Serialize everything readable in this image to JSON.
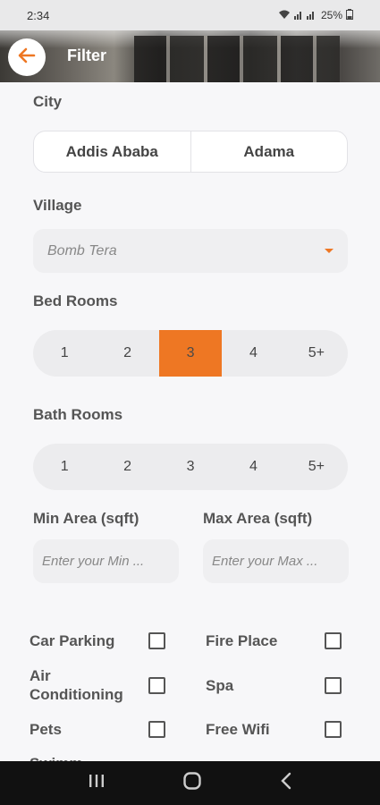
{
  "status_bar": {
    "time": "2:34",
    "battery": "25%"
  },
  "header": {
    "title": "Filter"
  },
  "city": {
    "label": "City",
    "options": [
      "Addis Ababa",
      "Adama"
    ]
  },
  "village": {
    "label": "Village",
    "value": "Bomb Tera"
  },
  "bedrooms": {
    "label": "Bed Rooms",
    "options": [
      "1",
      "2",
      "3",
      "4",
      "5+"
    ],
    "selected": "3"
  },
  "bathrooms": {
    "label": "Bath Rooms",
    "options": [
      "1",
      "2",
      "3",
      "4",
      "5+"
    ]
  },
  "min_area": {
    "label": "Min Area (sqft)",
    "placeholder": "Enter your Min ..."
  },
  "max_area": {
    "label": "Max Area (sqft)",
    "placeholder": "Enter your Max ..."
  },
  "amenities": {
    "car_parking": "Car Parking",
    "fire_place": "Fire Place",
    "air_conditioning_1": "Air",
    "air_conditioning_2": "Conditioning",
    "spa": "Spa",
    "pets": "Pets",
    "free_wifi": "Free Wifi",
    "cut_off": "Swimm..."
  },
  "colors": {
    "accent": "#ee7723"
  },
  "icons": {
    "back": "arrow-left-icon",
    "wifi": "wifi-icon",
    "signal": "signal-icon",
    "battery": "battery-icon",
    "dropdown": "caret-down-icon",
    "recents": "recents-icon",
    "home": "home-icon",
    "nav_back": "back-chevron-icon"
  }
}
